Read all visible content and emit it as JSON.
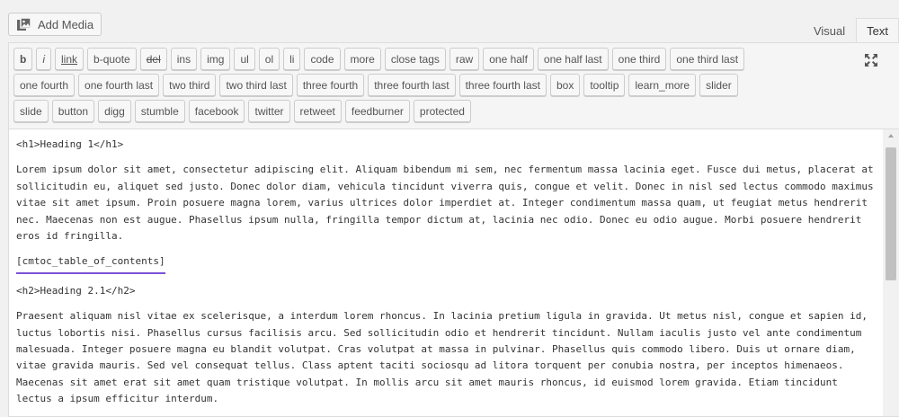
{
  "media": {
    "add_label": "Add Media"
  },
  "tabs": {
    "visual": "Visual",
    "text": "Text"
  },
  "toolbar": {
    "rows": [
      [
        "b",
        "i",
        "link",
        "b-quote",
        "del",
        "ins",
        "img",
        "ul",
        "ol",
        "li",
        "code",
        "more",
        "close tags",
        "raw",
        "one half",
        "one half last",
        "one third",
        "one third last"
      ],
      [
        "one fourth",
        "one fourth last",
        "two third",
        "two third last",
        "three fourth",
        "three fourth last",
        "three fourth last",
        "box",
        "tooltip",
        "learn_more",
        "slider"
      ],
      [
        "slide",
        "button",
        "digg",
        "stumble",
        "facebook",
        "twitter",
        "retweet",
        "feedburner",
        "protected"
      ]
    ]
  },
  "content": {
    "h1_line": "<h1>Heading 1</h1>",
    "para1": "Lorem ipsum dolor sit amet, consectetur adipiscing elit. Aliquam bibendum mi sem, nec fermentum massa lacinia eget. Fusce dui metus, placerat at sollicitudin eu, aliquet sed justo. Donec dolor diam, vehicula tincidunt viverra quis, congue et velit. Donec in nisl sed lectus commodo maximus vitae sit amet ipsum. Proin posuere magna lorem, varius ultrices dolor imperdiet at. Integer condimentum massa quam, ut feugiat metus hendrerit nec. Maecenas non est augue. Phasellus ipsum nulla, fringilla tempor dictum at, lacinia nec odio. Donec eu odio augue. Morbi posuere hendrerit eros id fringilla.",
    "shortcode": "[cmtoc_table_of_contents]",
    "h2_line": "<h2>Heading 2.1</h2>",
    "para2": "Praesent aliquam nisl vitae ex scelerisque, a interdum lorem rhoncus. In lacinia pretium ligula in gravida. Ut metus nisl, congue et sapien id, luctus lobortis nisi. Phasellus cursus facilisis arcu. Sed sollicitudin odio et hendrerit tincidunt. Nullam iaculis justo vel ante condimentum malesuada. Integer posuere magna eu blandit volutpat. Cras volutpat at massa in pulvinar. Phasellus quis commodo libero. Duis ut ornare diam, vitae gravida mauris. Sed vel consequat tellus. Class aptent taciti sociosqu ad litora torquent per conubia nostra, per inceptos himenaeos. Maecenas sit amet erat sit amet quam tristique volutpat. In mollis arcu sit amet mauris rhoncus, id euismod lorem gravida. Etiam tincidunt lectus a ipsum efficitur interdum."
  },
  "colors": {
    "shortcode_underline": "#7b52d6",
    "background": "#f1f1f1"
  },
  "icons": {
    "media": "media-icon",
    "fullscreen": "fullscreen-icon"
  }
}
